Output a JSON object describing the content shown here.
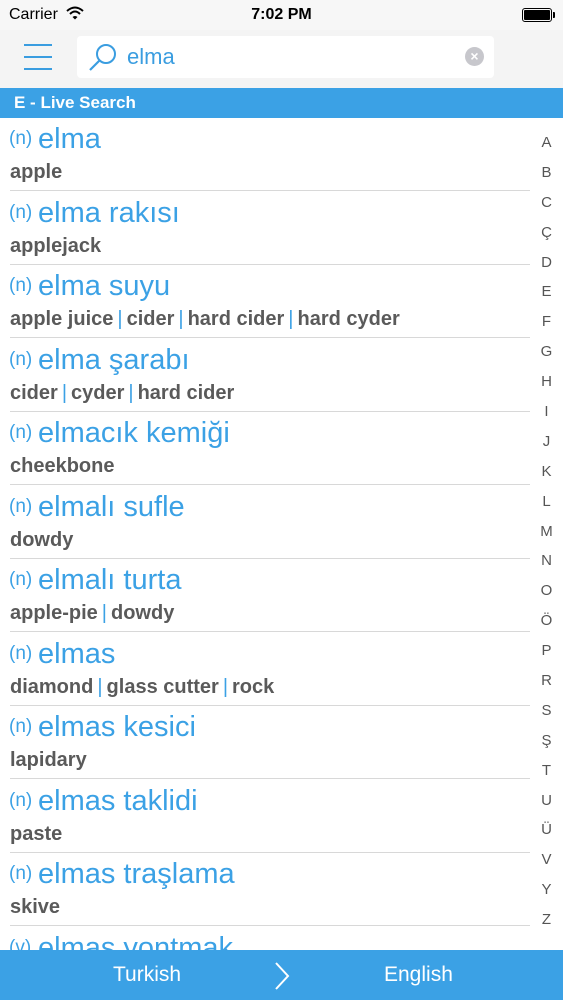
{
  "status": {
    "carrier": "Carrier",
    "time": "7:02 PM"
  },
  "search": {
    "value": "elma"
  },
  "section": {
    "title": "E - Live Search"
  },
  "entries": [
    {
      "pos": "(n)",
      "term": "elma",
      "translations": [
        "apple"
      ]
    },
    {
      "pos": "(n)",
      "term": "elma rakısı",
      "translations": [
        "applejack"
      ]
    },
    {
      "pos": "(n)",
      "term": "elma suyu",
      "translations": [
        "apple juice",
        "cider",
        "hard cider",
        "hard cyder"
      ]
    },
    {
      "pos": "(n)",
      "term": "elma şarabı",
      "translations": [
        "cider",
        "cyder",
        "hard cider"
      ]
    },
    {
      "pos": "(n)",
      "term": "elmacık kemiği",
      "translations": [
        "cheekbone"
      ]
    },
    {
      "pos": "(n)",
      "term": "elmalı sufle",
      "translations": [
        "dowdy"
      ]
    },
    {
      "pos": "(n)",
      "term": "elmalı turta",
      "translations": [
        "apple-pie",
        "dowdy"
      ]
    },
    {
      "pos": "(n)",
      "term": "elmas",
      "translations": [
        "diamond",
        "glass cutter",
        "rock"
      ]
    },
    {
      "pos": "(n)",
      "term": "elmas kesici",
      "translations": [
        "lapidary"
      ]
    },
    {
      "pos": "(n)",
      "term": "elmas taklidi",
      "translations": [
        "paste"
      ]
    },
    {
      "pos": "(n)",
      "term": "elmas traşlama",
      "translations": [
        "skive"
      ]
    },
    {
      "pos": "(v)",
      "term": "elmas yontmak",
      "translations": []
    }
  ],
  "index_letters": [
    "A",
    "B",
    "C",
    "Ç",
    "D",
    "E",
    "F",
    "G",
    "H",
    "I",
    "J",
    "K",
    "L",
    "M",
    "N",
    "O",
    "Ö",
    "P",
    "R",
    "S",
    "Ş",
    "T",
    "U",
    "Ü",
    "V",
    "Y",
    "Z"
  ],
  "bottom": {
    "source_language": "Turkish",
    "target_language": "English"
  },
  "colors": {
    "accent": "#3ba1e5",
    "translation_text": "#5a5a5a"
  }
}
